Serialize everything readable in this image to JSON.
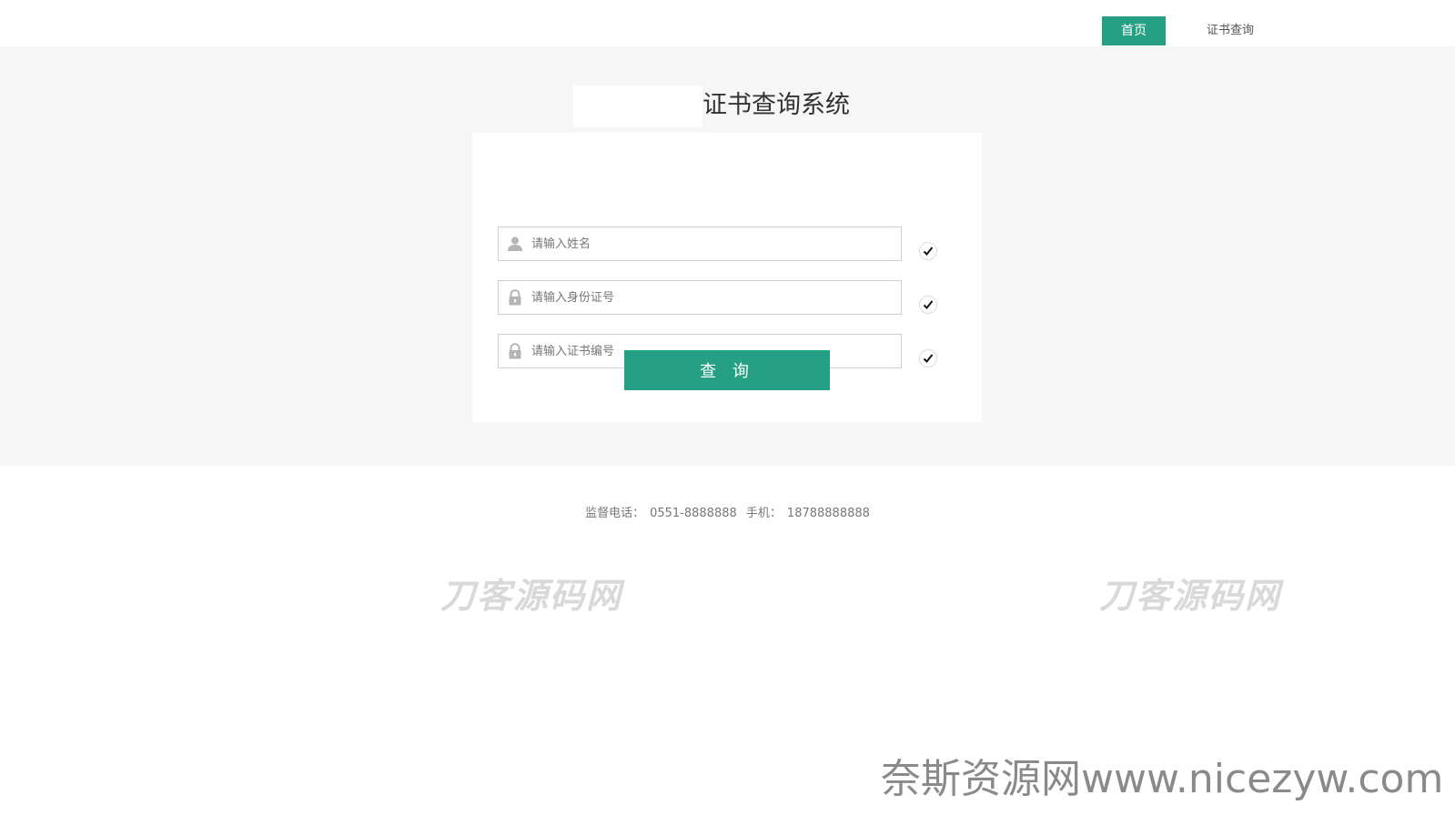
{
  "nav": {
    "home_label": "首页",
    "cert_query_label": "证书查询",
    "active_color": "#26a084"
  },
  "main": {
    "title": "证书查询系统",
    "fields": [
      {
        "icon": "user-icon",
        "placeholder": "请输入姓名",
        "value": ""
      },
      {
        "icon": "lock-icon",
        "placeholder": "请输入身份证号",
        "value": ""
      },
      {
        "icon": "lock-icon",
        "placeholder": "请输入证书编号",
        "value": ""
      }
    ],
    "query_button_label": "查 询"
  },
  "footer": {
    "supervision_phone_label": "监督电话：",
    "supervision_phone": "0551-8888888",
    "mobile_label": "手机：",
    "mobile": "18788888888"
  },
  "watermarks": {
    "faded_text": "刀客源码网",
    "site_text": "奈斯资源网www.nicezyw.com"
  }
}
